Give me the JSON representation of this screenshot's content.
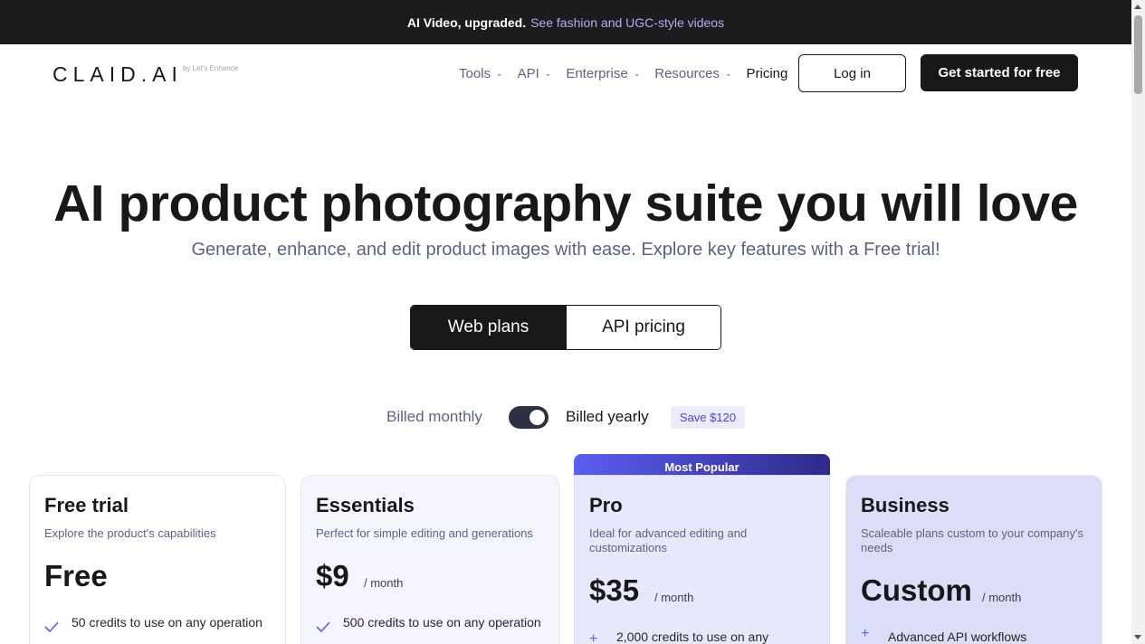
{
  "announcement": {
    "bold_text": "AI Video, upgraded.",
    "link_text": "See fashion and UGC-style videos"
  },
  "header": {
    "logo": "CLAID.AI",
    "logo_sub": "by Let's Enhance",
    "nav": [
      {
        "label": "Tools",
        "dropdown": true
      },
      {
        "label": "API",
        "dropdown": true
      },
      {
        "label": "Enterprise",
        "dropdown": true
      },
      {
        "label": "Resources",
        "dropdown": true
      },
      {
        "label": "Pricing",
        "dropdown": false
      }
    ],
    "login_label": "Log in",
    "cta_label": "Get started for free"
  },
  "hero": {
    "title": "AI product photography suite you will love",
    "subtitle": "Generate, enhance, and edit product images with ease. Explore key features with a Free trial!"
  },
  "plan_toggle": {
    "web_label": "Web plans",
    "api_label": "API pricing",
    "active": "web"
  },
  "billing": {
    "monthly_label": "Billed monthly",
    "yearly_label": "Billed yearly",
    "save_label": "Save $120",
    "yearly_selected": true
  },
  "plans": {
    "popular_label": "Most Popular",
    "free": {
      "name": "Free trial",
      "desc": "Explore the product's capabilities",
      "price": "Free",
      "feature": "50 credits to use on any operation"
    },
    "essentials": {
      "name": "Essentials",
      "desc": "Perfect for simple editing and generations",
      "price": "$9",
      "per": "/ month",
      "feature": "500 credits to use on any operation"
    },
    "pro": {
      "name": "Pro",
      "desc": "Ideal for advanced editing and customizations",
      "price": "$35",
      "per": "/ month",
      "feature": "2,000 credits to use on any"
    },
    "business": {
      "name": "Business",
      "desc": "Scaleable plans custom to your company's needs",
      "price": "Custom",
      "per": "/ month",
      "feature": "Advanced API workflows"
    }
  },
  "colors": {
    "dark": "#18181b",
    "accent": "#5b5ef0",
    "muted": "#5b6383"
  }
}
